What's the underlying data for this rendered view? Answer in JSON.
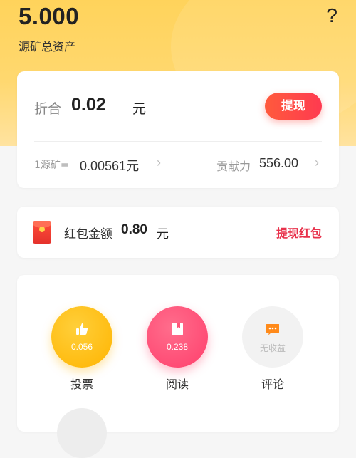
{
  "header": {
    "total_value": "5.000",
    "total_label": "源矿总资产",
    "help_glyph": "?"
  },
  "balance": {
    "equiv_label": "折合",
    "equiv_value": "0.02",
    "equiv_unit": "元",
    "withdraw_label": "提现",
    "rate_label": "1源矿=",
    "rate_value": "0.00561元",
    "contrib_label": "贡献力",
    "contrib_value": "556.00"
  },
  "redpack": {
    "label": "红包金额",
    "value": "0.80",
    "unit": "元",
    "link": "提现红包"
  },
  "tasks": [
    {
      "label": "投票",
      "amount": "0.056",
      "icon": "thumbs-up-icon"
    },
    {
      "label": "阅读",
      "amount": "0.238",
      "icon": "bookmark-icon"
    },
    {
      "label": "评论",
      "amount": "无收益",
      "icon": "comment-icon"
    }
  ],
  "colors": {
    "accent_red": "#ff4a45",
    "vote_yellow": "#ffb400",
    "read_pink": "#ff3f6c",
    "comment_orange": "#ff8a1a"
  }
}
